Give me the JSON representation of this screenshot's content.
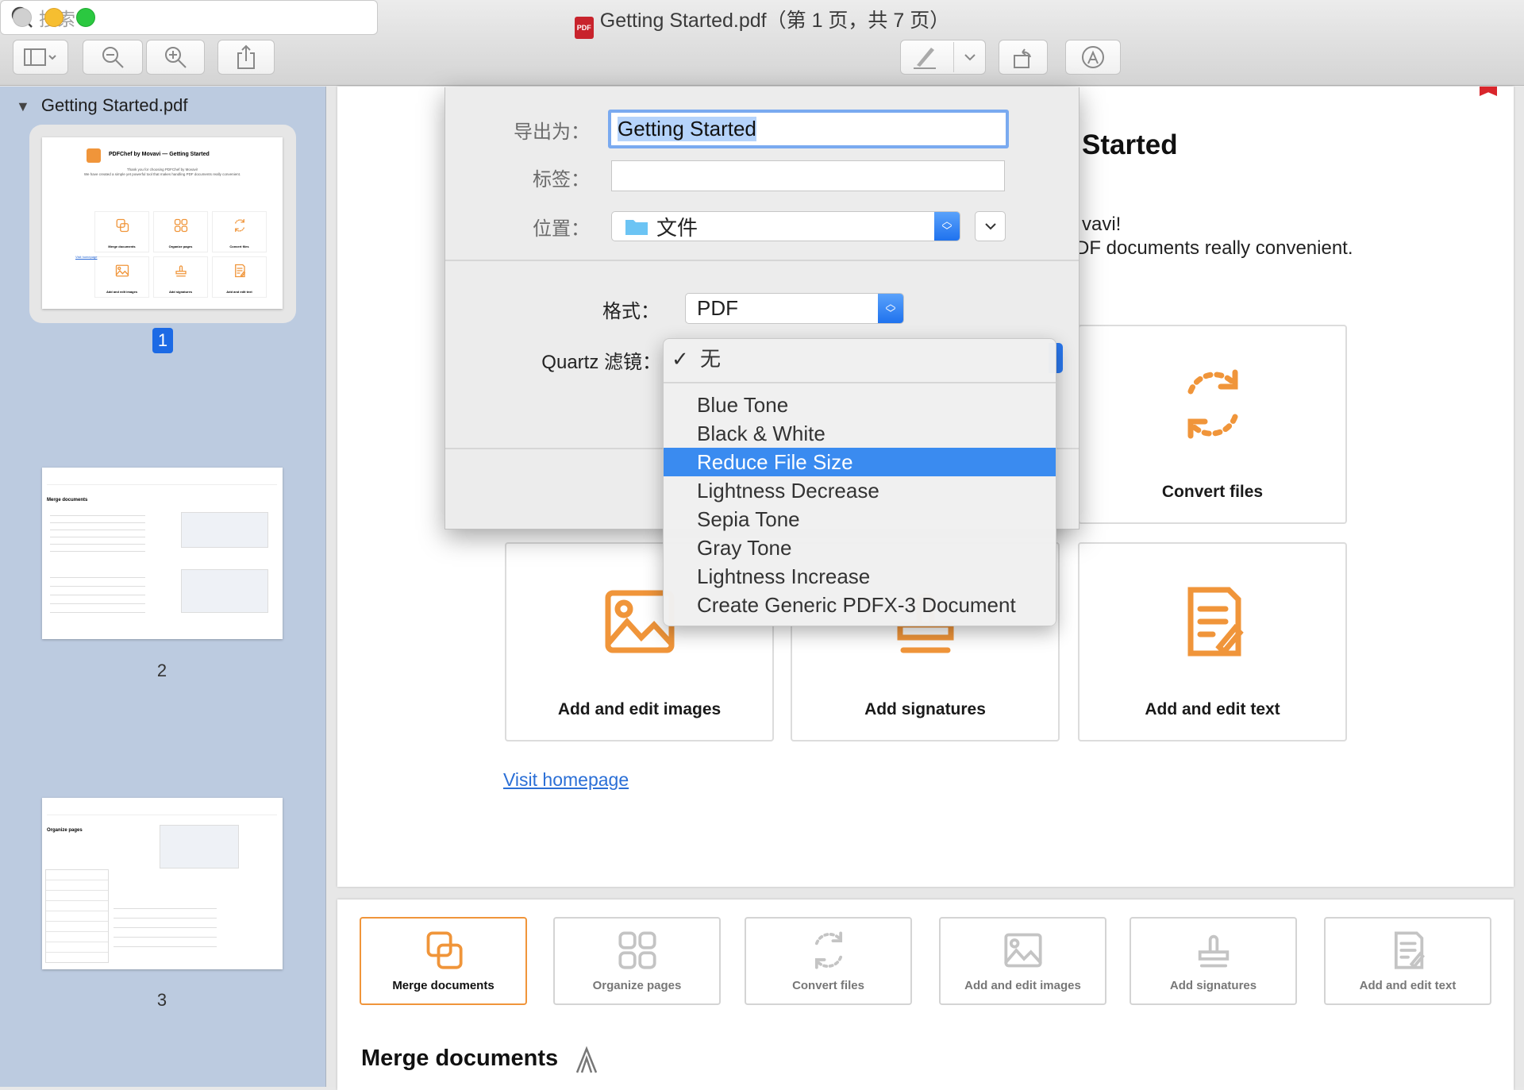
{
  "window": {
    "title": "Getting Started.pdf（第 1 页，共 7 页）",
    "file_icon": "pdf-icon"
  },
  "toolbar": {
    "search_placeholder": "搜索",
    "buttons": [
      "sidebar-toggle",
      "zoom-out",
      "zoom-in",
      "share",
      "markup",
      "rotate",
      "annotate"
    ]
  },
  "sidebar": {
    "document": "Getting Started.pdf",
    "pages": [
      {
        "label": "1",
        "selected": true
      },
      {
        "label": "2"
      },
      {
        "label": "3"
      }
    ],
    "thumb1": {
      "title": "PDFChef by Movavi — Getting Started",
      "line1": "Thank you for choosing PDFChef by Movavi!",
      "line2": "We have created a simple yet powerful tool that makes handling PDF documents really convenient.",
      "link": "Visit homepage"
    },
    "thumb2": {
      "heading": "Merge documents"
    },
    "thumb3": {
      "heading": "Organize pages"
    }
  },
  "page1": {
    "title_fragment": "Started",
    "line1_fragment": "vavi!",
    "line2_fragment": "DF documents really convenient.",
    "link": "Visit homepage",
    "cards": [
      "Merge documents",
      "Organize pages",
      "Convert files",
      "Add and edit images",
      "Add signatures",
      "Add and edit text"
    ]
  },
  "page2": {
    "tabs": [
      "Merge documents",
      "Organize pages",
      "Convert files",
      "Add and edit images",
      "Add signatures",
      "Add and edit text"
    ],
    "active_tab": "Merge documents",
    "heading": "Merge documents"
  },
  "dialog": {
    "export_as_label": "导出为：",
    "export_as_value": "Getting Started",
    "tags_label": "标签：",
    "tags_value": "",
    "location_label": "位置：",
    "location_value": "文件",
    "format_label": "格式：",
    "format_value": "PDF",
    "quartz_label": "Quartz 滤镜："
  },
  "quartz_menu": {
    "checked": "无",
    "items": [
      "Blue Tone",
      "Black & White",
      "Reduce File Size",
      "Lightness Decrease",
      "Sepia Tone",
      "Gray Tone",
      "Lightness Increase",
      "Create Generic PDFX-3 Document"
    ],
    "highlighted": "Reduce File Size"
  },
  "colors": {
    "accent_orange": "#f0953a",
    "selection_blue": "#3a8bf0",
    "sidebar": "#bccbe0"
  }
}
